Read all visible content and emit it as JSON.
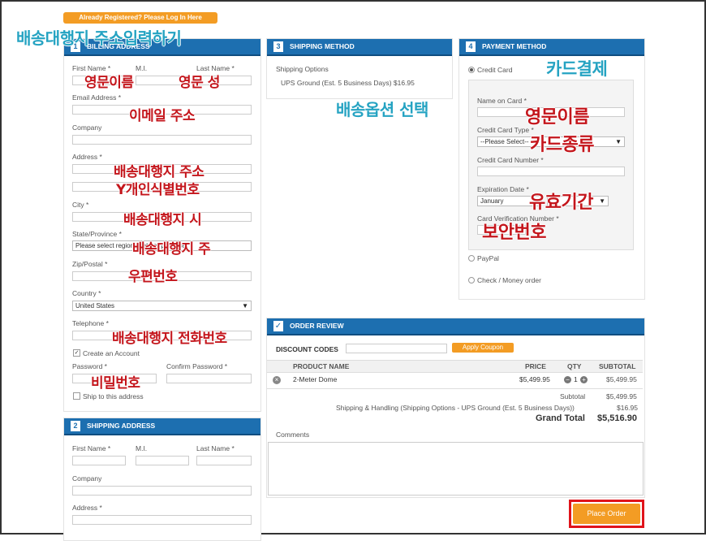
{
  "login_banner": "Already Registered? Please Log In Here",
  "annotations": {
    "shipping_address_title": "배송대행지 주소입력하기",
    "card_payment": "카드결제",
    "shipping_option": "배송옵션 선택",
    "en_first_name": "영문이름",
    "en_last_name": "영문 성",
    "email": "이메일 주소",
    "address": "배송대행지 주소",
    "personal_id": "Y개인식별번호",
    "city": "배송대행지 시",
    "state": "배송대행지 주",
    "zip": "우편번호",
    "telephone": "배송대행지 전화번호",
    "password": "비밀번호",
    "card_name": "영문이름",
    "card_type": "카드종류",
    "expiration": "유효기간",
    "cvv": "보안번호"
  },
  "billing": {
    "num": "1",
    "title": "BILLING ADDRESS",
    "first_name": "First Name *",
    "mi": "M.I.",
    "last_name": "Last Name *",
    "email": "Email Address *",
    "company": "Company",
    "address": "Address *",
    "city": "City *",
    "state": "State/Province *",
    "state_value": "Please select region, state or province",
    "zip": "Zip/Postal *",
    "country": "Country *",
    "country_value": "United States",
    "telephone": "Telephone *",
    "create_account": "Create an Account",
    "password": "Password *",
    "confirm_password": "Confirm Password *",
    "ship_to_this": "Ship to this address"
  },
  "shipping_address": {
    "num": "2",
    "title": "SHIPPING ADDRESS",
    "first_name": "First Name *",
    "mi": "M.I.",
    "last_name": "Last Name *",
    "company": "Company",
    "address": "Address *"
  },
  "shipping_method": {
    "num": "3",
    "title": "SHIPPING METHOD",
    "options_label": "Shipping Options",
    "option": "UPS Ground (Est. 5 Business Days) $16.95"
  },
  "payment": {
    "num": "4",
    "title": "PAYMENT METHOD",
    "credit_card": "Credit Card",
    "name_on_card": "Name on Card *",
    "card_type": "Credit Card Type *",
    "card_type_value": "--Please Select--",
    "card_number": "Credit Card Number *",
    "expiration": "Expiration Date *",
    "expiration_month": "January",
    "cvv": "Card Verification Number *",
    "paypal": "PayPal",
    "check": "Check / Money order"
  },
  "review": {
    "title": "ORDER REVIEW",
    "discount_label": "DISCOUNT CODES",
    "apply_coupon": "Apply Coupon",
    "headers": [
      "PRODUCT NAME",
      "PRICE",
      "QTY",
      "SUBTOTAL"
    ],
    "item": {
      "name": "2-Meter Dome",
      "price": "$5,499.95",
      "qty": "1",
      "subtotal": "$5,499.95"
    },
    "subtotal_label": "Subtotal",
    "subtotal_value": "$5,499.95",
    "shipping_label": "Shipping & Handling (Shipping Options - UPS Ground (Est. 5 Business Days))",
    "shipping_value": "$16.95",
    "grand_label": "Grand Total",
    "grand_value": "$5,516.90",
    "comments": "Comments",
    "place_order": "Place Order"
  },
  "colors": {
    "accent": "#1d6fb0",
    "orange": "#f39c24",
    "annotation_red": "#c4161c",
    "annotation_blue": "#25a3c2"
  }
}
